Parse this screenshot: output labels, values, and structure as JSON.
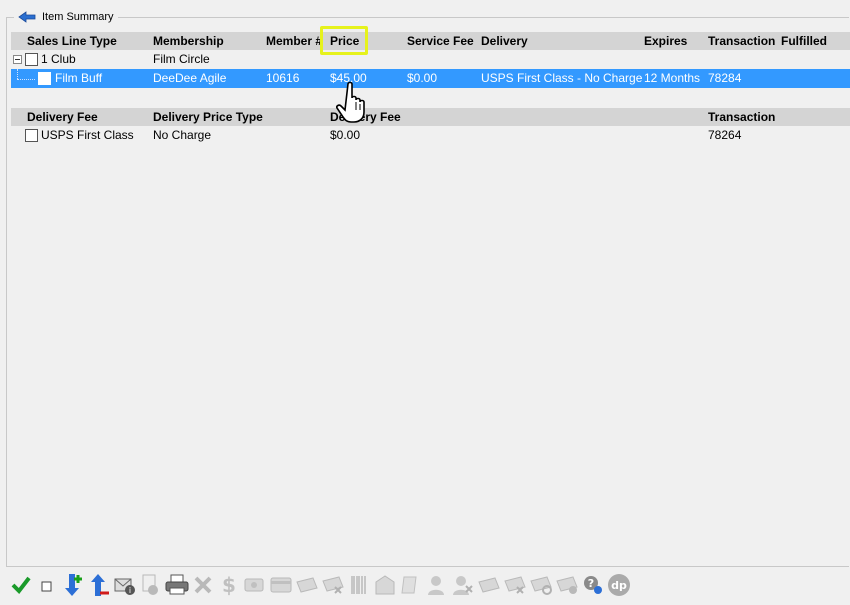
{
  "window": {
    "title": "Item Summary"
  },
  "grid1": {
    "headers": [
      "Sales Line Type",
      "Membership",
      "Member #",
      "Price",
      "Service Fee",
      "Delivery",
      "Expires",
      "Transaction",
      "Fulfilled"
    ],
    "group_row": {
      "type": "1 Club",
      "membership": "Film Circle"
    },
    "item_row": {
      "type": "Film Buff",
      "membership": "DeeDee Agile",
      "member_no": "10616",
      "price": "$45.00",
      "service_fee": "$0.00",
      "delivery": "USPS First Class - No Charge",
      "expires": "12 Months",
      "transaction": "78284"
    }
  },
  "grid2": {
    "headers": [
      "Delivery Fee",
      "Delivery Price Type",
      "Delivery Fee",
      "Transaction"
    ],
    "row": {
      "delivery_fee": "USPS First Class",
      "price_type": "No Charge",
      "fee": "$0.00",
      "transaction": "78264"
    }
  },
  "toolbar": {
    "icons": [
      "checkmark-icon",
      "checkbox-icon",
      "move-down-icon",
      "move-up-icon",
      "email-info-icon",
      "document-info-icon",
      "print-icon",
      "delete-icon",
      "dollar-icon",
      "payment-icon",
      "card-icon",
      "ticket-icon",
      "ticket-cancel-icon",
      "barcode-icon",
      "envelope-icon",
      "scroll-icon",
      "user-icon",
      "user-cancel-icon",
      "ticket-arrow-icon",
      "ticket-cancel2-icon",
      "ticket-refresh-icon",
      "ticket-info-icon",
      "help-icon",
      "dp-icon"
    ]
  },
  "colors": {
    "selection": "#3399ff",
    "header_bg": "#d4d4d4",
    "highlight": "#e6f21c"
  }
}
